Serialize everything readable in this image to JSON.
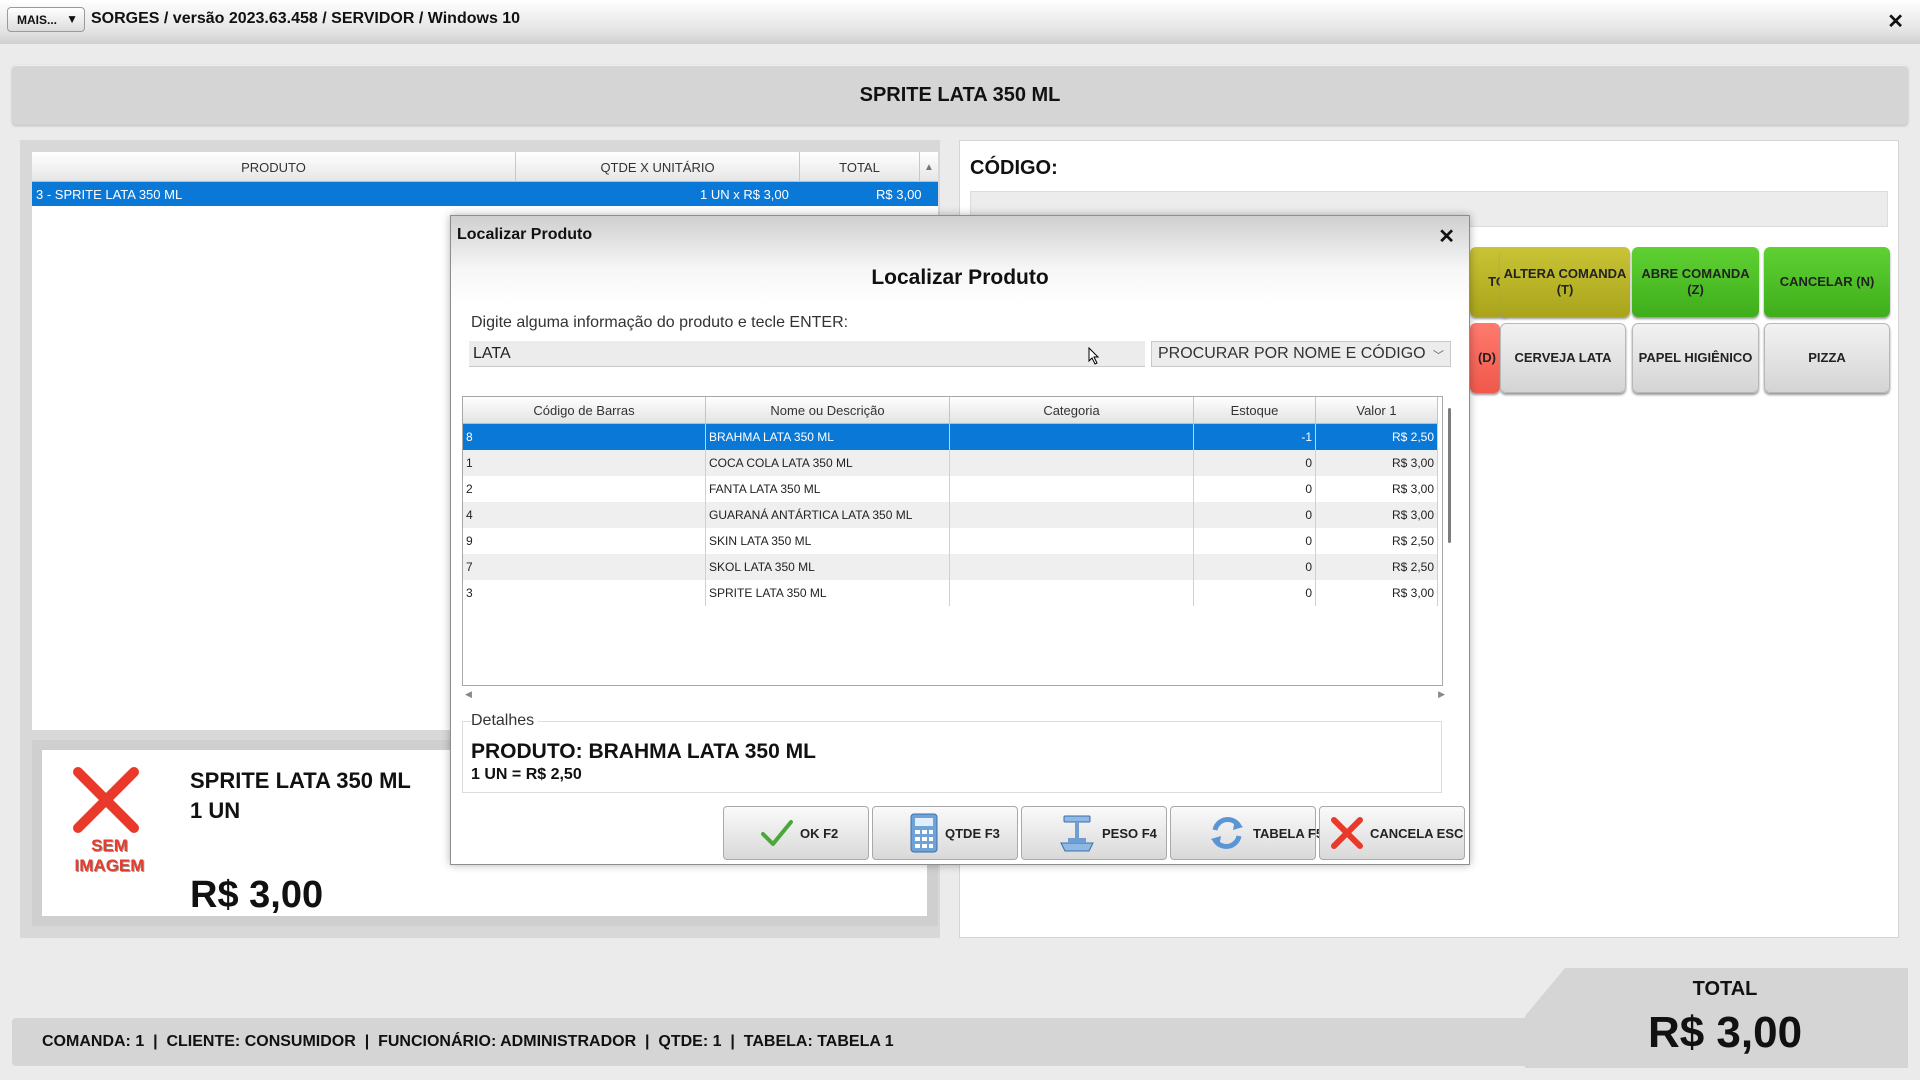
{
  "window": {
    "more_label": "MAIS...",
    "more_arrow": "▼",
    "title": "SORGES / versão 2023.63.458 / SERVIDOR / Windows 10",
    "close": "✕"
  },
  "banner": {
    "product": "SPRITE LATA 350 ML"
  },
  "items": {
    "headers": [
      "PRODUTO",
      "QTDE X UNITÁRIO",
      "TOTAL"
    ],
    "rows": [
      {
        "product": "3 - SPRITE LATA 350 ML",
        "qty_unit": "1 UN x R$ 3,00",
        "total": "R$ 3,00"
      }
    ]
  },
  "current_item": {
    "no_image": "SEM IMAGEM",
    "name": "SPRITE LATA 350 ML",
    "qty": "1  UN",
    "price": "R$ 3,00"
  },
  "right": {
    "code_label": "CÓDIGO:",
    "buttons": [
      {
        "label": "TO",
        "color": "olive"
      },
      {
        "label": "ALTERA COMANDA (T)",
        "color": "olive"
      },
      {
        "label": "ABRE COMANDA (Z)",
        "color": "green"
      },
      {
        "label": "CANCELAR (N)",
        "color": "green"
      },
      {
        "label": "(D)",
        "color": "red"
      },
      {
        "label": "CERVEJA LATA",
        "color": "grey"
      },
      {
        "label": "PAPEL HIGIÊNICO",
        "color": "grey"
      },
      {
        "label": "PIZZA",
        "color": "grey"
      }
    ]
  },
  "status": {
    "text": "COMANDA: 1  |  CLIENTE: CONSUMIDOR  |  FUNCIONÁRIO: ADMINISTRADOR  |  QTDE: 1  |  TABELA: TABELA 1"
  },
  "total": {
    "label": "TOTAL",
    "value": "R$ 3,00"
  },
  "dialog": {
    "title": "Localizar Produto",
    "close": "✕",
    "heading": "Localizar Produto",
    "instruction": "Digite alguma informação do produto e tecle ENTER:",
    "search_value": "LATA",
    "search_mode": "PROCURAR POR NOME E CÓDIGO",
    "columns": [
      "Código de Barras",
      "Nome ou Descrição",
      "Categoria",
      "Estoque",
      "Valor 1"
    ],
    "rows": [
      {
        "code": "8",
        "name": "BRAHMA LATA 350 ML",
        "category": "",
        "stock": "-1",
        "value": "R$ 2,50",
        "selected": true
      },
      {
        "code": "1",
        "name": "COCA COLA LATA 350 ML",
        "category": "",
        "stock": "0",
        "value": "R$ 3,00"
      },
      {
        "code": "2",
        "name": "FANTA LATA 350 ML",
        "category": "",
        "stock": "0",
        "value": "R$ 3,00"
      },
      {
        "code": "4",
        "name": "GUARANÁ ANTÁRTICA LATA 350 ML",
        "category": "",
        "stock": "0",
        "value": "R$ 3,00"
      },
      {
        "code": "9",
        "name": "SKIN LATA 350 ML",
        "category": "",
        "stock": "0",
        "value": "R$ 2,50"
      },
      {
        "code": "7",
        "name": "SKOL LATA 350 ML",
        "category": "",
        "stock": "0",
        "value": "R$ 2,50"
      },
      {
        "code": "3",
        "name": "SPRITE LATA 350 ML",
        "category": "",
        "stock": "0",
        "value": "R$ 3,00"
      }
    ],
    "details_label": "Detalhes",
    "details_product": "PRODUTO: BRAHMA LATA 350 ML",
    "details_price": "1 UN = R$ 2,50",
    "buttons": [
      {
        "label": "OK F2",
        "icon": "check-icon"
      },
      {
        "label": "QTDE F3",
        "icon": "calculator-icon"
      },
      {
        "label": "PESO F4",
        "icon": "scale-icon"
      },
      {
        "label": "TABELA F5",
        "icon": "refresh-icon"
      },
      {
        "label": "CANCELA ESC",
        "icon": "cancel-x-icon"
      }
    ]
  }
}
